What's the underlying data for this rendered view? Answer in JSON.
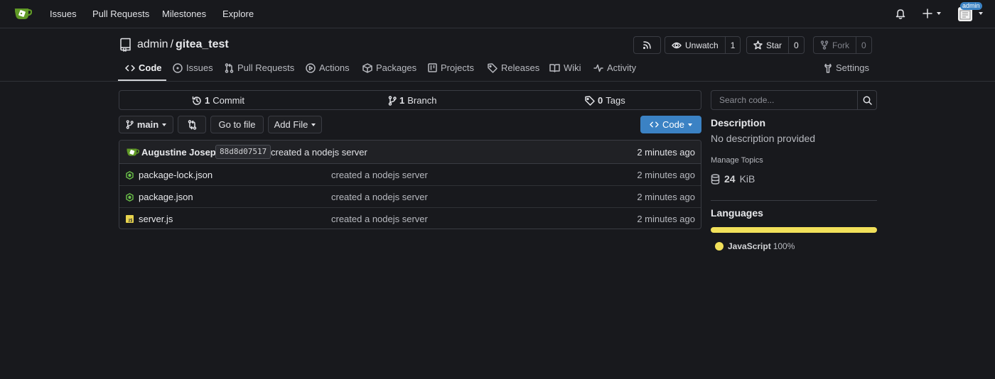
{
  "nav": {
    "links": [
      "Issues",
      "Pull Requests",
      "Milestones",
      "Explore"
    ],
    "avatar_badge": "admin"
  },
  "repo": {
    "owner": "admin",
    "separator": "/",
    "name": "gitea_test",
    "watch": {
      "label": "Unwatch",
      "count": "1"
    },
    "star": {
      "label": "Star",
      "count": "0"
    },
    "fork": {
      "label": "Fork",
      "count": "0"
    }
  },
  "tabs": [
    "Code",
    "Issues",
    "Pull Requests",
    "Actions",
    "Packages",
    "Projects",
    "Releases",
    "Wiki",
    "Activity"
  ],
  "settings_label": "Settings",
  "summary": {
    "commits": {
      "count": "1",
      "label": "Commit"
    },
    "branches": {
      "count": "1",
      "label": "Branch"
    },
    "tags": {
      "count": "0",
      "label": "Tags"
    }
  },
  "toolbar": {
    "branch": "main",
    "go_to_file": "Go to file",
    "add_file": "Add File",
    "code": "Code"
  },
  "latest_commit": {
    "author": "Augustine Joseph",
    "sha": "88d8d07517",
    "message": "created a nodejs server",
    "time": "2 minutes ago"
  },
  "files": [
    {
      "name": "package-lock.json",
      "message": "created a nodejs server",
      "time": "2 minutes ago",
      "icon": "nodejs-icon"
    },
    {
      "name": "package.json",
      "message": "created a nodejs server",
      "time": "2 minutes ago",
      "icon": "nodejs-icon"
    },
    {
      "name": "server.js",
      "message": "created a nodejs server",
      "time": "2 minutes ago",
      "icon": "javascript-icon"
    }
  ],
  "sidebar": {
    "search_placeholder": "Search code...",
    "description_title": "Description",
    "description": "No description provided",
    "manage_topics": "Manage Topics",
    "size_value": "24",
    "size_unit": "KiB",
    "languages_title": "Languages",
    "languages": [
      {
        "name": "JavaScript",
        "percent": "100%",
        "fraction": 1.0,
        "color": "#f1e05a"
      }
    ]
  },
  "colors": {
    "accent": "#3b82c4",
    "gitea_green": "#609926",
    "background": "#18191d"
  }
}
